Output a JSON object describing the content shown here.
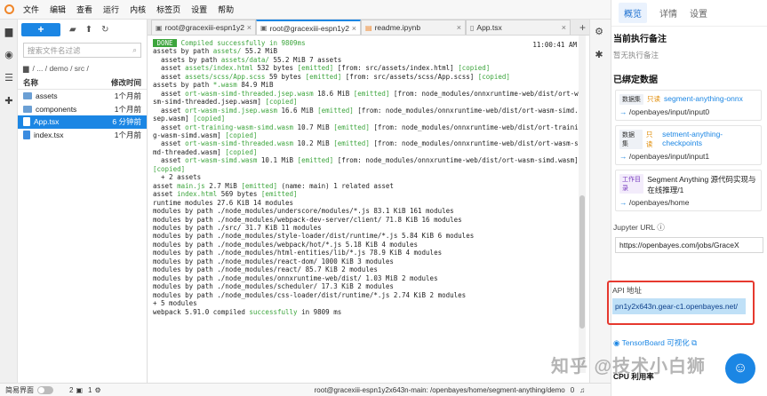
{
  "menu": [
    "文件",
    "编辑",
    "查看",
    "运行",
    "内核",
    "标签页",
    "设置",
    "帮助"
  ],
  "filebrowser": {
    "new_label": "+",
    "search_placeholder": "搜索文件名过滤",
    "breadcrumb": "/ ... / demo / src /",
    "col_name": "名称",
    "col_modified": "修改时间",
    "rows": [
      {
        "name": "assets",
        "time": "1个月前",
        "type": "folder"
      },
      {
        "name": "components",
        "time": "1个月前",
        "type": "folder"
      },
      {
        "name": "App.tsx",
        "time": "6 分钟前",
        "type": "file",
        "selected": true
      },
      {
        "name": "index.tsx",
        "time": "1个月前",
        "type": "file"
      }
    ]
  },
  "tabs": [
    {
      "label": "root@gracexiii-espn1y2xl",
      "active": false
    },
    {
      "label": "root@gracexiii-espn1y2xl",
      "active": true
    },
    {
      "label": "readme.ipynb",
      "active": false
    },
    {
      "label": "App.tsx",
      "active": false
    }
  ],
  "terminal": {
    "done_label": " DONE ",
    "done_msg": " Compiled successfully in 9809ms",
    "timestamp": "11:00:41 AM",
    "lines": [
      [
        [
          "assets by path ",
          ""
        ],
        [
          "assets/",
          1
        ],
        [
          " 55.2 MiB",
          ""
        ]
      ],
      [
        [
          "  assets by path ",
          ""
        ],
        [
          "assets/data/",
          1
        ],
        [
          " 55.2 MiB 7 assets",
          ""
        ]
      ],
      [
        [
          "  asset ",
          ""
        ],
        [
          "assets/index.html",
          1
        ],
        [
          " 532 bytes ",
          ""
        ],
        [
          "[emitted]",
          1
        ],
        [
          " [from: src/assets/index.html] ",
          ""
        ],
        [
          "[copied]",
          1
        ]
      ],
      [
        [
          "  asset ",
          ""
        ],
        [
          "assets/scss/App.scss",
          1
        ],
        [
          " 59 bytes ",
          ""
        ],
        [
          "[emitted]",
          1
        ],
        [
          " [from: src/assets/scss/App.scss] ",
          ""
        ],
        [
          "[copied]",
          1
        ]
      ],
      [
        [
          "assets by path ",
          ""
        ],
        [
          "*.wasm",
          1
        ],
        [
          " 84.9 MiB",
          ""
        ]
      ],
      [
        [
          "  asset ",
          ""
        ],
        [
          "ort-wasm-simd-threaded.jsep.wasm",
          1
        ],
        [
          " 18.6 MiB ",
          ""
        ],
        [
          "[emitted]",
          1
        ],
        [
          " [from: node_modules/onnxruntime-web/dist/ort-wa",
          ""
        ]
      ],
      [
        [
          "sm-simd-threaded.jsep.wasm] ",
          ""
        ],
        [
          "[copied]",
          1
        ]
      ],
      [
        [
          "  asset ",
          ""
        ],
        [
          "ort-wasm-simd.jsep.wasm",
          1
        ],
        [
          " 16.6 MiB ",
          ""
        ],
        [
          "[emitted]",
          1
        ],
        [
          " [from: node_modules/onnxruntime-web/dist/ort-wasm-simd.j",
          ""
        ]
      ],
      [
        [
          "sep.wasm] ",
          ""
        ],
        [
          "[copied]",
          1
        ]
      ],
      [
        [
          "  asset ",
          ""
        ],
        [
          "ort-training-wasm-simd.wasm",
          1
        ],
        [
          " 10.7 MiB ",
          ""
        ],
        [
          "[emitted]",
          1
        ],
        [
          " [from: node_modules/onnxruntime-web/dist/ort-trainin",
          ""
        ]
      ],
      [
        [
          "g-wasm-simd.wasm] ",
          ""
        ],
        [
          "[copied]",
          1
        ]
      ],
      [
        [
          "  asset ",
          ""
        ],
        [
          "ort-wasm-simd-threaded.wasm",
          1
        ],
        [
          " 10.2 MiB ",
          ""
        ],
        [
          "[emitted]",
          1
        ],
        [
          " [from: node_modules/onnxruntime-web/dist/ort-wasm-si",
          ""
        ]
      ],
      [
        [
          "md-threaded.wasm] ",
          ""
        ],
        [
          "[copied]",
          1
        ]
      ],
      [
        [
          "  asset ",
          ""
        ],
        [
          "ort-wasm-simd.wasm",
          1
        ],
        [
          " 10.1 MiB ",
          ""
        ],
        [
          "[emitted]",
          1
        ],
        [
          " [from: node_modules/onnxruntime-web/dist/ort-wasm-simd.wasm]",
          ""
        ]
      ],
      [
        [
          "[copied]",
          1
        ]
      ],
      [
        [
          "  + 2 assets",
          ""
        ]
      ],
      [
        [
          "asset ",
          ""
        ],
        [
          "main.js",
          1
        ],
        [
          " 2.7 MiB ",
          ""
        ],
        [
          "[emitted]",
          1
        ],
        [
          " (name: main) 1 related asset",
          ""
        ]
      ],
      [
        [
          "asset ",
          ""
        ],
        [
          "index.html",
          1
        ],
        [
          " 569 bytes ",
          ""
        ],
        [
          "[emitted]",
          1
        ]
      ],
      [
        [
          "runtime modules 27.6 KiB 14 modules",
          ""
        ]
      ],
      [
        [
          "modules by path ./node_modules/underscore/modules/*.js 83.1 KiB 161 modules",
          ""
        ]
      ],
      [
        [
          "modules by path ./node_modules/webpack-dev-server/client/ 71.8 KiB 16 modules",
          ""
        ]
      ],
      [
        [
          "modules by path ./src/ 31.7 KiB 11 modules",
          ""
        ]
      ],
      [
        [
          "modules by path ./node_modules/style-loader/dist/runtime/*.js 5.84 KiB 6 modules",
          ""
        ]
      ],
      [
        [
          "modules by path ./node_modules/webpack/hot/*.js 5.18 KiB 4 modules",
          ""
        ]
      ],
      [
        [
          "modules by path ./node_modules/html-entities/lib/*.js 78.9 KiB 4 modules",
          ""
        ]
      ],
      [
        [
          "modules by path ./node_modules/react-dom/ 1000 KiB 3 modules",
          ""
        ]
      ],
      [
        [
          "modules by path ./node_modules/react/ 85.7 KiB 2 modules",
          ""
        ]
      ],
      [
        [
          "modules by path ./node_modules/onnxruntime-web/dist/ 1.03 MiB 2 modules",
          ""
        ]
      ],
      [
        [
          "modules by path ./node_modules/scheduler/ 17.3 KiB 2 modules",
          ""
        ]
      ],
      [
        [
          "modules by path ./node_modules/css-loader/dist/runtime/*.js 2.74 KiB 2 modules",
          ""
        ]
      ],
      [
        [
          "+ 5 modules",
          ""
        ]
      ],
      [
        [
          "webpack 5.91.0 compiled ",
          ""
        ],
        [
          "successfully",
          1
        ],
        [
          " in 9809 ms",
          ""
        ]
      ]
    ]
  },
  "statusbar": {
    "simple_label": "简易界面",
    "count1": "2",
    "count2": "1",
    "path": "root@gracexiii-espn1y2x643n-main: /openbayes/home/segment-anything/demo",
    "position": "0"
  },
  "sidebar": {
    "tabs": [
      "概览",
      "详情",
      "设置"
    ],
    "note_title": "当前执行备注",
    "note_empty": "暂无执行备注",
    "bound_title": "已绑定数据",
    "datasets": [
      {
        "badge": "数据集",
        "ro": "只读",
        "name": "segment-anything-onnx",
        "path": "/openbayes/input/input0"
      },
      {
        "badge": "数据集",
        "ro": "只读",
        "name": "setment-anything-checkpoints",
        "path": "/openbayes/input/input1"
      }
    ],
    "workspace": {
      "badge": "工作目录",
      "name": "Segment Anything 源代码实现与在线推理/1",
      "path": "/openbayes/home"
    },
    "jupyter_label": "Jupyter URL",
    "jupyter_url": "https://openbayes.com/jobs/GraceX",
    "api_label": "API 地址",
    "api_url": "pn1y2x643n.gear-c1.openbayes.net/",
    "tensorboard": "TensorBoard 可视化",
    "cpu_label": "CPU 利用率",
    "watermark": "知乎 @技术小白狮"
  }
}
